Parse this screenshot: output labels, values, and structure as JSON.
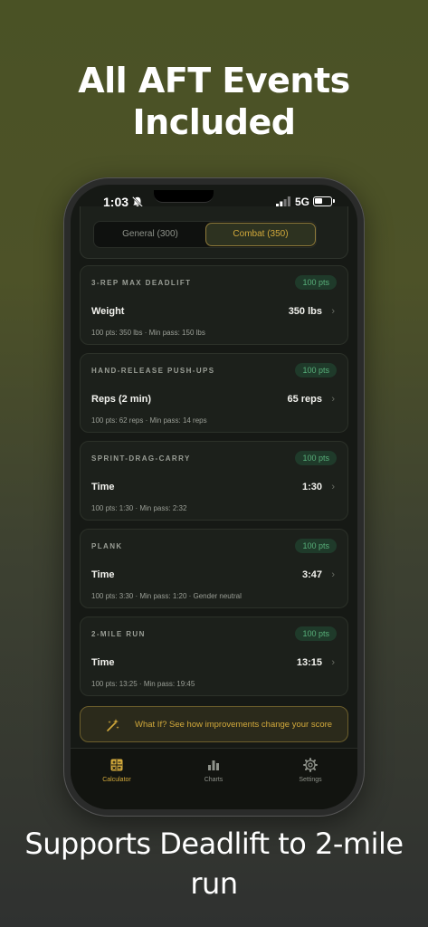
{
  "promo": {
    "headline": "All AFT Events Included",
    "caption": "Supports Deadlift to 2-mile run"
  },
  "status_bar": {
    "time": "1:03",
    "network": "5G",
    "icons": [
      "bell-slash-icon",
      "signal-icon",
      "battery-icon"
    ]
  },
  "segment": {
    "general_label": "General (300)",
    "combat_label": "Combat (350)",
    "selected": "Combat (350)"
  },
  "events": [
    {
      "name": "3-REP MAX DEADLIFT",
      "points": "100 pts",
      "metric_label": "Weight",
      "metric_value": "350 lbs",
      "meta": "100 pts: 350 lbs  ·  Min pass: 150 lbs"
    },
    {
      "name": "HAND-RELEASE PUSH-UPS",
      "points": "100 pts",
      "metric_label": "Reps (2 min)",
      "metric_value": "65 reps",
      "meta": "100 pts: 62 reps  ·  Min pass: 14 reps"
    },
    {
      "name": "SPRINT-DRAG-CARRY",
      "points": "100 pts",
      "metric_label": "Time",
      "metric_value": "1:30",
      "meta": "100 pts: 1:30  ·  Min pass: 2:32"
    },
    {
      "name": "PLANK",
      "points": "100 pts",
      "metric_label": "Time",
      "metric_value": "3:47",
      "meta": "100 pts: 3:30  ·  Min pass: 1:20  ·  Gender neutral"
    },
    {
      "name": "2-MILE RUN",
      "points": "100 pts",
      "metric_label": "Time",
      "metric_value": "13:15",
      "meta": "100 pts: 13:25  ·  Min pass: 19:45"
    }
  ],
  "whatif": {
    "text": "What If? See how improvements change your score",
    "icon": "sparkle-wand-icon"
  },
  "tabbar": {
    "tabs": [
      {
        "label": "Calculator",
        "icon": "calculator-icon",
        "active": true
      },
      {
        "label": "Charts",
        "icon": "bar-chart-icon",
        "active": false
      },
      {
        "label": "Settings",
        "icon": "gear-icon",
        "active": false
      }
    ]
  },
  "colors": {
    "accent_gold": "#d2a93b",
    "badge_green": "#58b07a",
    "screen_bg": "#161915",
    "card_bg": "#1c201b"
  }
}
